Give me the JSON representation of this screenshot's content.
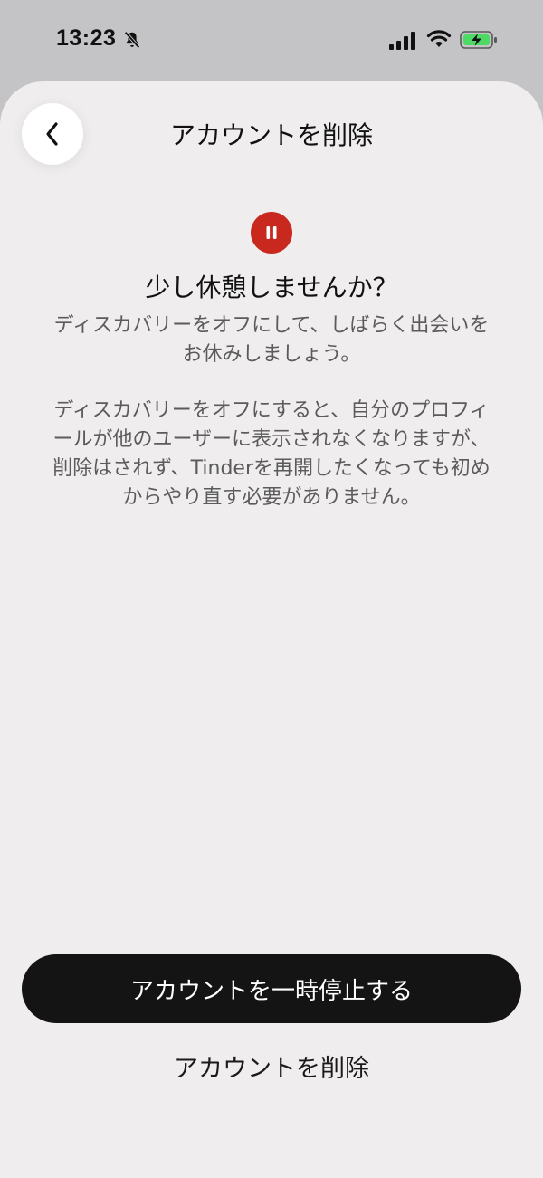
{
  "status_bar": {
    "time": "13:23"
  },
  "header": {
    "title": "アカウントを削除"
  },
  "content": {
    "headline": "少し休憩しませんか？",
    "paragraph1": "ディスカバリーをオフにして、しばらく出会いを\nお休みしましょう。",
    "paragraph2": "ディスカバリーをオフにすると、自分のプロフィ\nールが他のユーザーに表示されなくなりますが、\n削除はされず、Tinderを再開したくなっても初め\nからやり直す必要がありません。"
  },
  "actions": {
    "pause_label": "アカウントを一時停止する",
    "delete_label": "アカウントを削除"
  },
  "colors": {
    "accent": "#c9281f",
    "sheet_background": "#efedee",
    "primary_button": "#151414",
    "battery_fill": "#4cd964"
  },
  "icons": {
    "back": "chevron-left-icon",
    "pause": "pause-icon",
    "bell_off": "bell-slash-icon",
    "signal": "cellular-signal-icon",
    "wifi": "wifi-icon",
    "battery": "battery-charging-icon"
  }
}
